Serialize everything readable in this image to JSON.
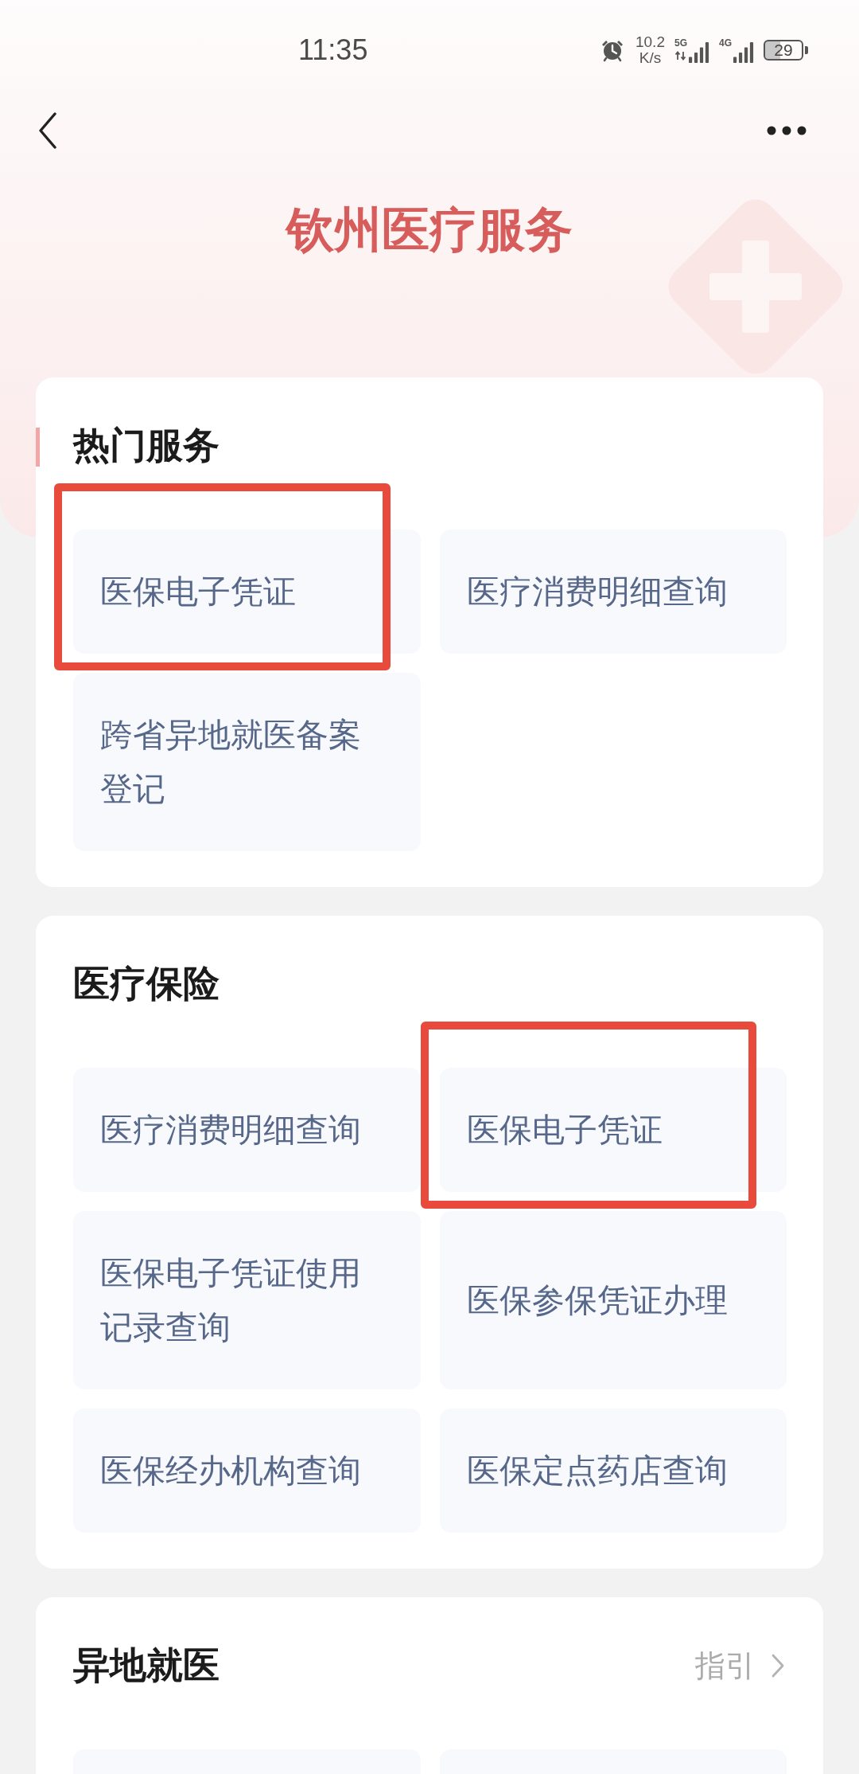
{
  "status_bar": {
    "time": "11:35",
    "net_speed": "10.2",
    "net_speed_unit": "K/s",
    "signals": [
      {
        "network": "5G",
        "data_active": true
      },
      {
        "network": "4G",
        "data_active": false
      }
    ],
    "battery": "29"
  },
  "header": {
    "title": "钦州医疗服务"
  },
  "sections": [
    {
      "title": "热门服务",
      "marked": true,
      "tiles": [
        {
          "label": "医保电子凭证",
          "highlighted": true
        },
        {
          "label": "医疗消费明细查询",
          "highlighted": false
        },
        {
          "label": "跨省异地就医备案登记",
          "highlighted": false
        }
      ]
    },
    {
      "title": "医疗保险",
      "marked": false,
      "tiles": [
        {
          "label": "医疗消费明细查询",
          "highlighted": false
        },
        {
          "label": "医保电子凭证",
          "highlighted": true
        },
        {
          "label": "医保电子凭证使用记录查询",
          "highlighted": false
        },
        {
          "label": "医保参保凭证办理",
          "highlighted": false
        },
        {
          "label": "医保经办机构查询",
          "highlighted": false
        },
        {
          "label": "医保定点药店查询",
          "highlighted": false
        }
      ]
    },
    {
      "title": "异地就医",
      "marked": false,
      "link": "指引",
      "tiles_cut_off": true
    }
  ]
}
